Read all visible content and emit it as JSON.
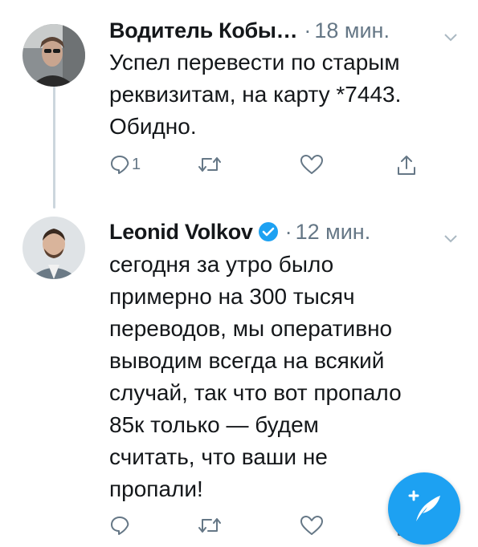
{
  "colors": {
    "text": "#14171a",
    "secondary": "#657786",
    "accent": "#1da1f2",
    "thread_line": "#ccd6dd"
  },
  "tweets": [
    {
      "author": "Водитель Кобы…",
      "separator": "·",
      "time": "18 мин.",
      "verified": false,
      "text": "Успел перевести по старым\nреквизитам, на карту *7443.\nОбидно.",
      "reply_count": "1",
      "icons": [
        "reply-icon",
        "retweet-icon",
        "like-icon",
        "share-icon"
      ]
    },
    {
      "author": "Leonid Volkov",
      "separator": "·",
      "time": "12 мин.",
      "verified": true,
      "text": "сегодня за утро было\nпримерно на 300 тысяч\nпереводов, мы оперативно\nвыводим всегда на всякий\nслучай, так что вот пропало\n85к только — будем\nсчитать, что ваши не\nпропали!",
      "reply_count": "",
      "icons": [
        "reply-icon",
        "retweet-icon",
        "like-icon",
        "share-icon"
      ]
    }
  ],
  "compose_button": {
    "icon": "compose-tweet-icon"
  }
}
